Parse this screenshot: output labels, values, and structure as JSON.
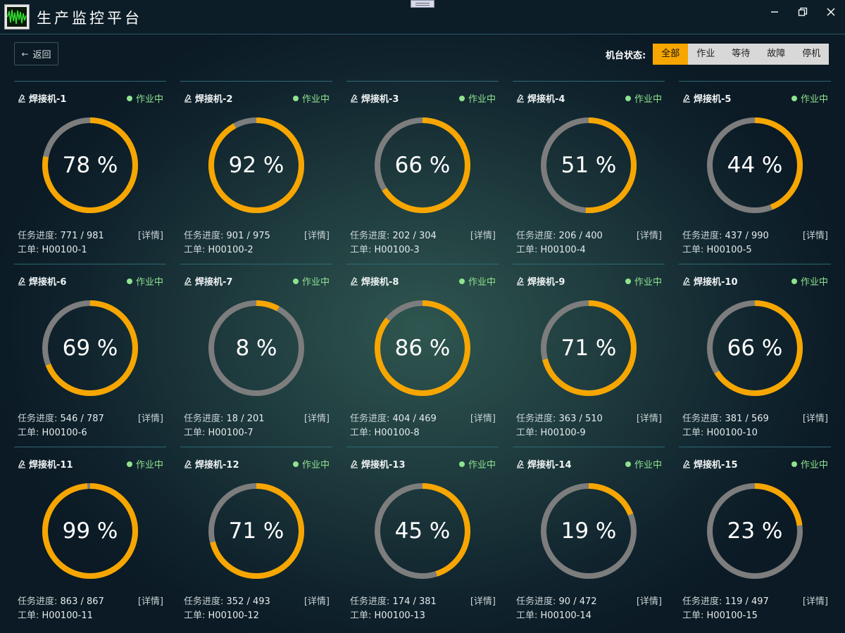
{
  "app": {
    "title": "生产监控平台"
  },
  "toolbar": {
    "back_label": "返回"
  },
  "filter": {
    "label": "机台状态:",
    "options": [
      "全部",
      "作业",
      "等待",
      "故障",
      "停机"
    ],
    "selected": "全部",
    "accent": "#f7a600"
  },
  "card_labels": {
    "progress": "任务进度:",
    "order": "工单:",
    "detail": "[详情]"
  },
  "colors": {
    "ring_fill": "#f7a600",
    "ring_track": "#7d7d7d",
    "status_working": "#8fe38f"
  },
  "machines": [
    {
      "name": "焊接机-1",
      "status": "作业中",
      "percent": 78,
      "done": 771,
      "total": 981,
      "progress": "771 / 981",
      "order": "H00100-1"
    },
    {
      "name": "焊接机-2",
      "status": "作业中",
      "percent": 92,
      "done": 901,
      "total": 975,
      "progress": "901 / 975",
      "order": "H00100-2"
    },
    {
      "name": "焊接机-3",
      "status": "作业中",
      "percent": 66,
      "done": 202,
      "total": 304,
      "progress": "202 / 304",
      "order": "H00100-3"
    },
    {
      "name": "焊接机-4",
      "status": "作业中",
      "percent": 51,
      "done": 206,
      "total": 400,
      "progress": "206 / 400",
      "order": "H00100-4"
    },
    {
      "name": "焊接机-5",
      "status": "作业中",
      "percent": 44,
      "done": 437,
      "total": 990,
      "progress": "437 / 990",
      "order": "H00100-5"
    },
    {
      "name": "焊接机-6",
      "status": "作业中",
      "percent": 69,
      "done": 546,
      "total": 787,
      "progress": "546 / 787",
      "order": "H00100-6"
    },
    {
      "name": "焊接机-7",
      "status": "作业中",
      "percent": 8,
      "done": 18,
      "total": 201,
      "progress": "18 / 201",
      "order": "H00100-7"
    },
    {
      "name": "焊接机-8",
      "status": "作业中",
      "percent": 86,
      "done": 404,
      "total": 469,
      "progress": "404 / 469",
      "order": "H00100-8"
    },
    {
      "name": "焊接机-9",
      "status": "作业中",
      "percent": 71,
      "done": 363,
      "total": 510,
      "progress": "363 / 510",
      "order": "H00100-9"
    },
    {
      "name": "焊接机-10",
      "status": "作业中",
      "percent": 66,
      "done": 381,
      "total": 569,
      "progress": "381 / 569",
      "order": "H00100-10"
    },
    {
      "name": "焊接机-11",
      "status": "作业中",
      "percent": 99,
      "done": 863,
      "total": 867,
      "progress": "863 / 867",
      "order": "H00100-11"
    },
    {
      "name": "焊接机-12",
      "status": "作业中",
      "percent": 71,
      "done": 352,
      "total": 493,
      "progress": "352 / 493",
      "order": "H00100-12"
    },
    {
      "name": "焊接机-13",
      "status": "作业中",
      "percent": 45,
      "done": 174,
      "total": 381,
      "progress": "174 / 381",
      "order": "H00100-13"
    },
    {
      "name": "焊接机-14",
      "status": "作业中",
      "percent": 19,
      "done": 90,
      "total": 472,
      "progress": "90 / 472",
      "order": "H00100-14"
    },
    {
      "name": "焊接机-15",
      "status": "作业中",
      "percent": 23,
      "done": 119,
      "total": 497,
      "progress": "119 / 497",
      "order": "H00100-15"
    }
  ]
}
